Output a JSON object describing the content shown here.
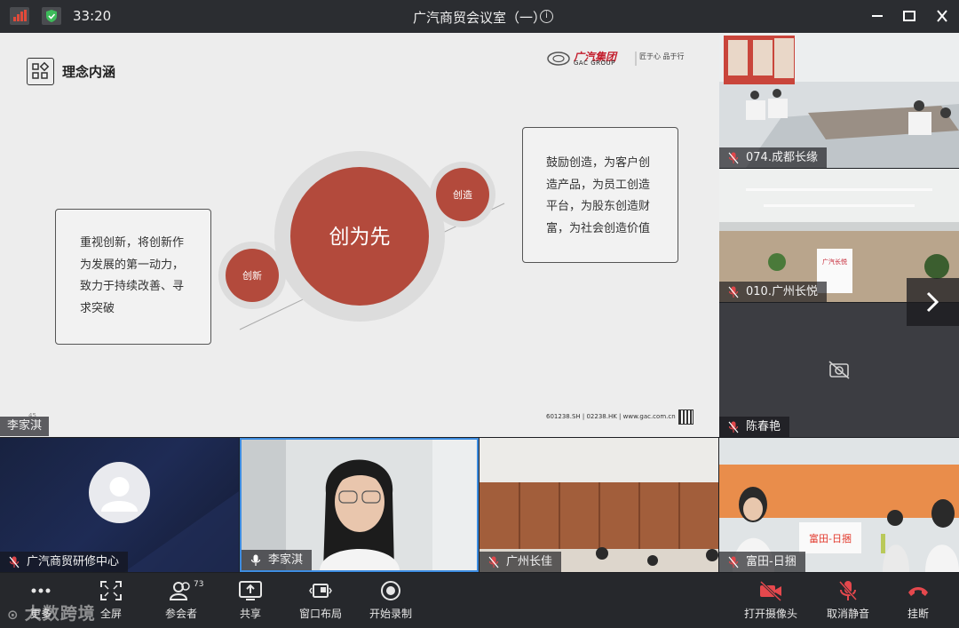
{
  "window": {
    "elapsed_time": "33:20",
    "title": "广汽商贸会议室（一）"
  },
  "shared_slide": {
    "heading": "理念内涵",
    "logo_text": "广汽集团",
    "logo_sub": "GAC GROUP",
    "logo_tagline": "匠于心 品于行",
    "center_circle": "创为先",
    "left_circle": "创新",
    "right_circle": "创造",
    "left_text": "重视创新，将创新作为发展的第一动力，致力于持续改善、寻求突破",
    "right_text": "鼓励创造，为客户创造产品，为员工创造平台，为股东创造财富，为社会创造价值",
    "footer": "601238.SH | 02238.HK | www.gac.com.cn",
    "page_number": "45",
    "presenter": "李家淇"
  },
  "side_videos": [
    {
      "name": "074.成都长缘",
      "muted": true
    },
    {
      "name": "010.广州长悦",
      "muted": true
    },
    {
      "name": "陈春艳",
      "muted": true,
      "camera_off": true
    }
  ],
  "bottom_videos": [
    {
      "name": "广汽商贸研修中心",
      "muted": true
    },
    {
      "name": "李家淇",
      "muted": false,
      "active_speaker": true
    },
    {
      "name": "广州长佳",
      "muted": true
    },
    {
      "name": "富田-日捆",
      "muted": true
    }
  ],
  "toolbar": {
    "more": "更多",
    "fullscreen": "全屏",
    "participants": "参会者",
    "participants_count": "73",
    "share": "共享",
    "layout": "窗口布局",
    "record": "开始录制",
    "camera": "打开摄像头",
    "unmute": "取消静音",
    "hangup": "挂断"
  },
  "watermark": "大数跨境",
  "colors": {
    "accent_red": "#b34a3c",
    "mute_red": "#e0464a",
    "active_border": "#3d8ce0",
    "hangup_red": "#e5484d"
  }
}
